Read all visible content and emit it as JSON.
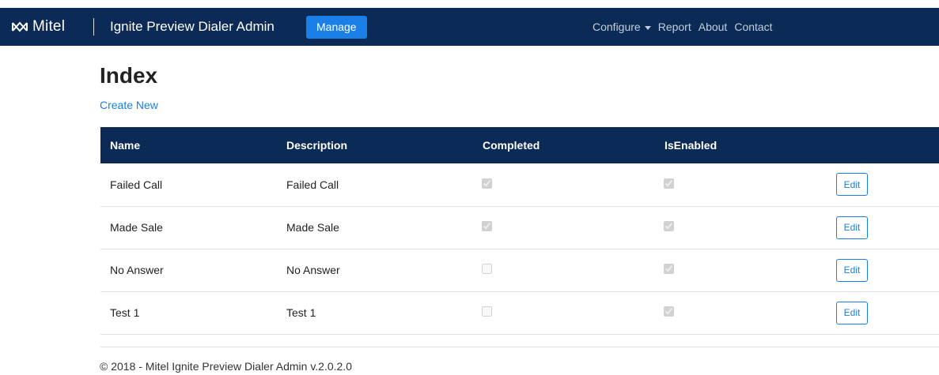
{
  "navbar": {
    "brand": "Mitel",
    "app_title": "Ignite Preview Dialer Admin",
    "manage_label": "Manage",
    "links": {
      "configure": "Configure",
      "report": "Report",
      "about": "About",
      "contact": "Contact"
    },
    "colors": {
      "background": "#0b2a55",
      "manage_button": "#1a7fe6"
    }
  },
  "main": {
    "title": "Index",
    "create_new": "Create New",
    "table": {
      "headers": {
        "name": "Name",
        "description": "Description",
        "completed": "Completed",
        "is_enabled": "IsEnabled"
      },
      "rows": [
        {
          "name": "Failed Call",
          "description": "Failed Call",
          "completed": true,
          "is_enabled": true,
          "action": "Edit"
        },
        {
          "name": "Made Sale",
          "description": "Made Sale",
          "completed": true,
          "is_enabled": true,
          "action": "Edit"
        },
        {
          "name": "No Answer",
          "description": "No Answer",
          "completed": false,
          "is_enabled": true,
          "action": "Edit"
        },
        {
          "name": "Test 1",
          "description": "Test 1",
          "completed": false,
          "is_enabled": true,
          "action": "Edit"
        }
      ]
    }
  },
  "footer": {
    "text": "© 2018 - Mitel Ignite Preview Dialer Admin v.2.0.2.0"
  }
}
